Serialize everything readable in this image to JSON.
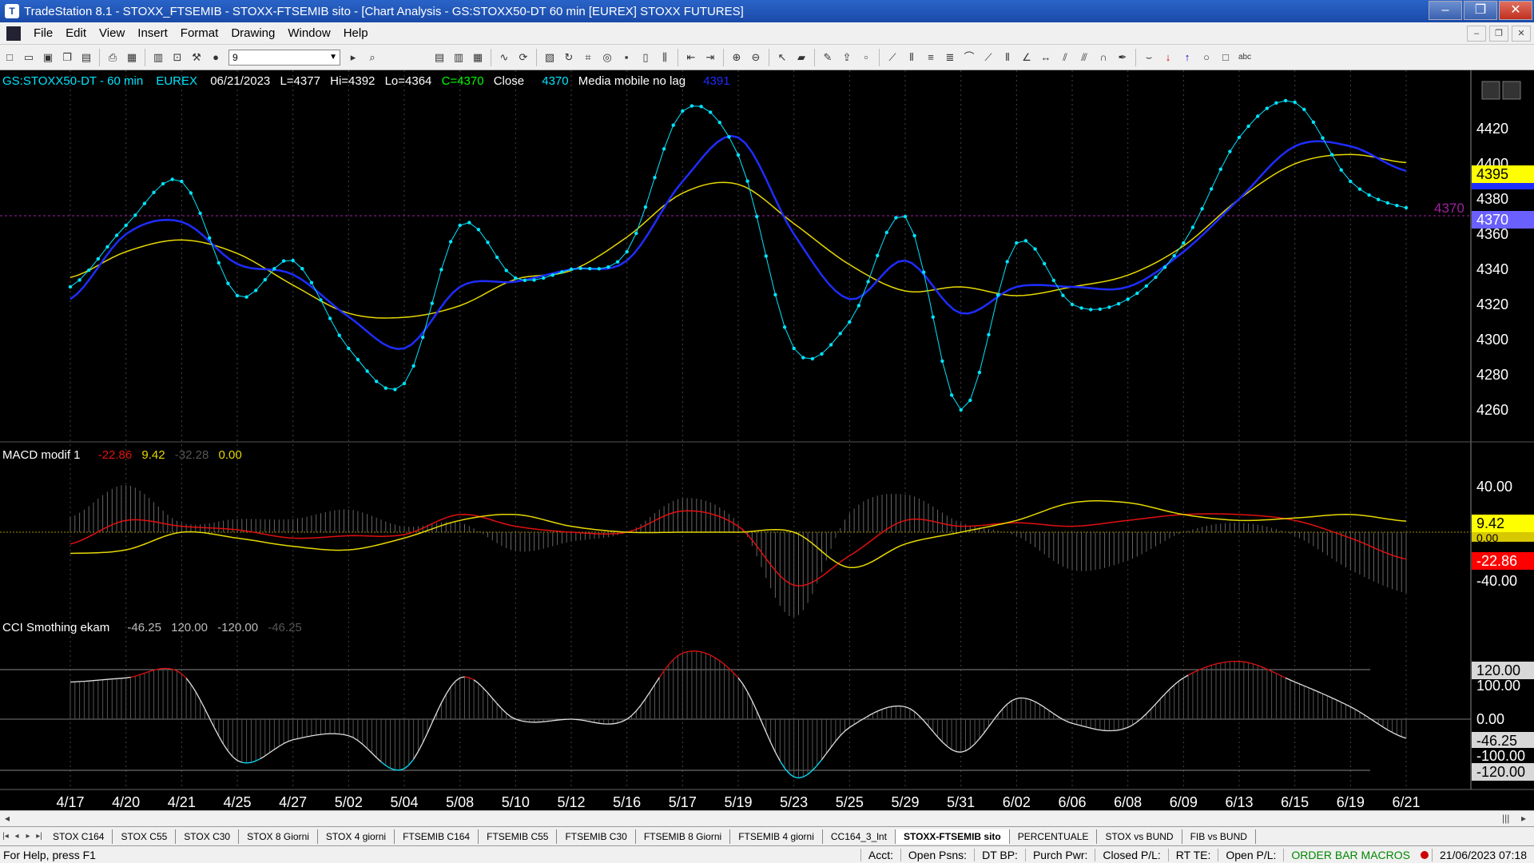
{
  "window": {
    "title": "TradeStation 8.1 - STOXX_FTSEMIB - STOXX-FTSEMIB sito - [Chart Analysis - GS:STOXX50-DT  60 min  [EUREX] STOXX FUTURES]"
  },
  "menu": [
    "File",
    "Edit",
    "View",
    "Insert",
    "Format",
    "Drawing",
    "Window",
    "Help"
  ],
  "toolbar": {
    "interval_value": "9"
  },
  "price_pane": {
    "symbol": "GS:STOXX50-DT - 60 min",
    "exchange": "EUREX",
    "date": "06/21/2023",
    "last": "L=4377",
    "high": "Hi=4392",
    "low": "Lo=4364",
    "close": "C=4370",
    "close_label": "Close",
    "close_value": "4370",
    "ma_label": "Media mobile no lag",
    "ma_value": "4391",
    "axis_ticks": [
      "4420",
      "4400",
      "4380",
      "4360",
      "4340",
      "4320",
      "4300",
      "4280",
      "4260"
    ],
    "badge_close": "4370",
    "badge_ma": "4395",
    "level_label": "4370"
  },
  "macd_pane": {
    "name": "MACD modif 1",
    "values": [
      "-22.86",
      "9.42",
      "-32.28",
      "0.00"
    ],
    "axis_ticks": [
      "40.00",
      "0.00",
      "-40.00"
    ],
    "badge_signal": "9.42",
    "badge_zero": "0.00",
    "badge_macd": "-22.86"
  },
  "cci_pane": {
    "name": "CCI Smothing ekam",
    "values": [
      "-46.25",
      "120.00",
      "-120.00",
      "-46.25"
    ],
    "axis_ticks": [
      "100.00",
      "0.00",
      "-100.00"
    ],
    "badge_top": "120.00",
    "badge_zero": "0.00",
    "badge_current": "-46.25",
    "badge_bottom": "-120.00"
  },
  "chart_data": {
    "type": "line",
    "x": [
      "4/17",
      "4/20",
      "4/21",
      "4/25",
      "4/27",
      "5/02",
      "5/04",
      "5/08",
      "5/10",
      "5/12",
      "5/16",
      "5/17",
      "5/19",
      "5/23",
      "5/25",
      "5/29",
      "5/31",
      "6/02",
      "6/06",
      "6/08",
      "6/09",
      "6/13",
      "6/15",
      "6/19",
      "6/21"
    ],
    "ylim": [
      4245,
      4440
    ],
    "series": [
      {
        "name": "Close",
        "values": [
          4325,
          4360,
          4385,
          4320,
          4340,
          4290,
          4270,
          4360,
          4330,
          4335,
          4345,
          4425,
          4400,
          4290,
          4305,
          4365,
          4255,
          4350,
          4315,
          4318,
          4350,
          4410,
          4430,
          4385,
          4370
        ]
      },
      {
        "name": "Media mobile no lag",
        "values": [
          4318,
          4355,
          4362,
          4338,
          4332,
          4308,
          4290,
          4325,
          4328,
          4335,
          4340,
          4385,
          4410,
          4355,
          4318,
          4340,
          4310,
          4325,
          4325,
          4325,
          4345,
          4375,
          4405,
          4405,
          4391
        ]
      }
    ],
    "panes": [
      {
        "name": "MACD modif 1",
        "ylim": [
          -50,
          50
        ],
        "series": [
          {
            "name": "MACD",
            "values": [
              -10,
              10,
              5,
              2,
              -5,
              -3,
              -2,
              15,
              5,
              0,
              0,
              18,
              5,
              -45,
              -20,
              10,
              5,
              8,
              5,
              10,
              15,
              15,
              10,
              -5,
              -22.86
            ]
          },
          {
            "name": "Signal",
            "values": [
              -18,
              -15,
              0,
              -5,
              -12,
              -15,
              -5,
              10,
              15,
              5,
              0,
              0,
              0,
              0,
              -30,
              -10,
              0,
              10,
              25,
              25,
              15,
              10,
              12,
              15,
              9.42
            ]
          }
        ]
      },
      {
        "name": "CCI Smothing ekam",
        "ylim": [
          -140,
          160
        ],
        "series": [
          {
            "name": "CCI",
            "values": [
              90,
              100,
              110,
              -100,
              -50,
              -40,
              -120,
              100,
              0,
              0,
              0,
              160,
              100,
              -140,
              -20,
              30,
              -80,
              50,
              -10,
              -20,
              100,
              140,
              90,
              30,
              -46.25
            ]
          }
        ]
      }
    ]
  },
  "tabs": [
    "STOX C164",
    "STOX C55",
    "STOX  C30",
    "STOX  8 Giorni",
    "STOX 4 giorni",
    "FTSEMIB C164",
    "FTSEMIB C55",
    "FTSEMIB C30",
    "FTSEMIB  8 Giorni",
    "FTSEMIB  4 giorni",
    "CC164_3_lnt",
    "STOXX-FTSEMIB sito",
    "PERCENTUALE",
    "STOX vs BUND",
    "FIB vs BUND"
  ],
  "active_tab": 11,
  "status": {
    "help": "For Help, press F1",
    "acct": "Acct:",
    "open_psns": "Open Psns:",
    "dt_bp": "DT BP:",
    "purch_pwr": "Purch Pwr:",
    "closed_pl": "Closed P/L:",
    "rt_te": "RT TE:",
    "open_pl": "Open P/L:",
    "macros": "ORDER BAR  MACROS",
    "datetime": "21/06/2023 07:18"
  },
  "colors": {
    "price": "#00e5ff",
    "ma": "#1e2dff",
    "slow_ma": "#e6d800",
    "macd": "#e01010",
    "signal": "#e6d800",
    "cci": "#e0e0e0",
    "axis_bg": "#d8d8d8"
  }
}
